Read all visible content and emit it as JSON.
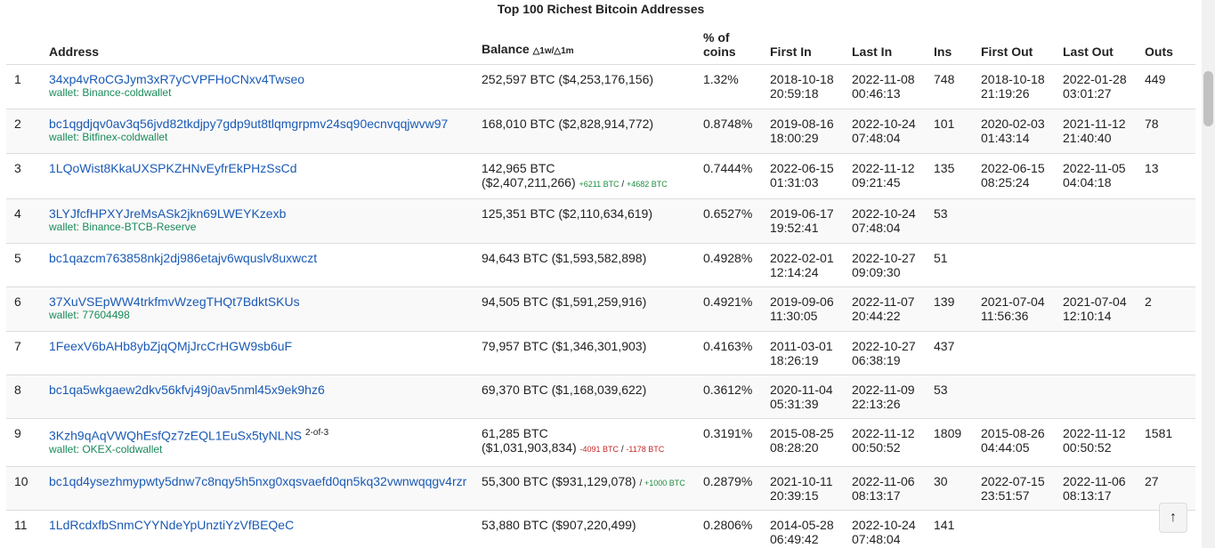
{
  "page": {
    "title": "Top 100 Richest Bitcoin Addresses"
  },
  "table": {
    "headers": {
      "address": "Address",
      "balance": "Balance",
      "balance_delta": "△1w/△1m",
      "pct_line1": "% of",
      "pct_line2": "coins",
      "first_in": "First In",
      "last_in": "Last In",
      "ins": "Ins",
      "first_out": "First Out",
      "last_out": "Last Out",
      "outs": "Outs"
    },
    "rows": [
      {
        "rank": "1",
        "address": "34xp4vRoCGJym3xR7yCVPFHoCNxv4Twseo",
        "wallet": "wallet: Binance-coldwallet",
        "balance": "252,597 BTC ($4,253,176,156)",
        "balance_l2": "",
        "delta_1w": "",
        "delta_1m": "",
        "delta_sign": "",
        "pct": "1.32%",
        "first_in_d": "2018-10-18",
        "first_in_t": "20:59:18",
        "last_in_d": "2022-11-08",
        "last_in_t": "00:46:13",
        "ins": "748",
        "first_out_d": "2018-10-18",
        "first_out_t": "21:19:26",
        "last_out_d": "2022-01-28",
        "last_out_t": "03:01:27",
        "outs": "449",
        "sup": ""
      },
      {
        "rank": "2",
        "address": "bc1qgdjqv0av3q56jvd82tkdjpy7gdp9ut8tlqmgrpmv24sq90ecnvqqjwvw97",
        "wallet": "wallet: Bitfinex-coldwallet",
        "balance": "168,010 BTC ($2,828,914,772)",
        "balance_l2": "",
        "delta_1w": "",
        "delta_1m": "",
        "delta_sign": "",
        "pct": "0.8748%",
        "first_in_d": "2019-08-16",
        "first_in_t": "18:00:29",
        "last_in_d": "2022-10-24",
        "last_in_t": "07:48:04",
        "ins": "101",
        "first_out_d": "2020-02-03",
        "first_out_t": "01:43:14",
        "last_out_d": "2021-11-12",
        "last_out_t": "21:40:40",
        "outs": "78",
        "sup": ""
      },
      {
        "rank": "3",
        "address": "1LQoWist8KkaUXSPKZHNvEyfrEkPHzSsCd",
        "wallet": "",
        "balance": "142,965 BTC",
        "balance_l2": "($2,407,211,266)",
        "delta_1w": "+6211 BTC",
        "delta_1m": "+4682 BTC",
        "delta_sign": "pos",
        "pct": "0.7444%",
        "first_in_d": "2022-06-15",
        "first_in_t": "01:31:03",
        "last_in_d": "2022-11-12",
        "last_in_t": "09:21:45",
        "ins": "135",
        "first_out_d": "2022-06-15",
        "first_out_t": "08:25:24",
        "last_out_d": "2022-11-05",
        "last_out_t": "04:04:18",
        "outs": "13",
        "sup": ""
      },
      {
        "rank": "4",
        "address": "3LYJfcfHPXYJreMsASk2jkn69LWEYKzexb",
        "wallet": "wallet: Binance-BTCB-Reserve",
        "balance": "125,351 BTC ($2,110,634,619)",
        "balance_l2": "",
        "delta_1w": "",
        "delta_1m": "",
        "delta_sign": "",
        "pct": "0.6527%",
        "first_in_d": "2019-06-17",
        "first_in_t": "19:52:41",
        "last_in_d": "2022-10-24",
        "last_in_t": "07:48:04",
        "ins": "53",
        "first_out_d": "",
        "first_out_t": "",
        "last_out_d": "",
        "last_out_t": "",
        "outs": "",
        "sup": ""
      },
      {
        "rank": "5",
        "address": "bc1qazcm763858nkj2dj986etajv6wquslv8uxwczt",
        "wallet": "",
        "balance": "94,643 BTC ($1,593,582,898)",
        "balance_l2": "",
        "delta_1w": "",
        "delta_1m": "",
        "delta_sign": "",
        "pct": "0.4928%",
        "first_in_d": "2022-02-01",
        "first_in_t": "12:14:24",
        "last_in_d": "2022-10-27",
        "last_in_t": "09:09:30",
        "ins": "51",
        "first_out_d": "",
        "first_out_t": "",
        "last_out_d": "",
        "last_out_t": "",
        "outs": "",
        "sup": ""
      },
      {
        "rank": "6",
        "address": "37XuVSEpWW4trkfmvWzegTHQt7BdktSKUs",
        "wallet": "wallet: 77604498",
        "balance": "94,505 BTC ($1,591,259,916)",
        "balance_l2": "",
        "delta_1w": "",
        "delta_1m": "",
        "delta_sign": "",
        "pct": "0.4921%",
        "first_in_d": "2019-09-06",
        "first_in_t": "11:30:05",
        "last_in_d": "2022-11-07",
        "last_in_t": "20:44:22",
        "ins": "139",
        "first_out_d": "2021-07-04",
        "first_out_t": "11:56:36",
        "last_out_d": "2021-07-04",
        "last_out_t": "12:10:14",
        "outs": "2",
        "sup": ""
      },
      {
        "rank": "7",
        "address": "1FeexV6bAHb8ybZjqQMjJrcCrHGW9sb6uF",
        "wallet": "",
        "balance": "79,957 BTC ($1,346,301,903)",
        "balance_l2": "",
        "delta_1w": "",
        "delta_1m": "",
        "delta_sign": "",
        "pct": "0.4163%",
        "first_in_d": "2011-03-01",
        "first_in_t": "18:26:19",
        "last_in_d": "2022-10-27",
        "last_in_t": "06:38:19",
        "ins": "437",
        "first_out_d": "",
        "first_out_t": "",
        "last_out_d": "",
        "last_out_t": "",
        "outs": "",
        "sup": ""
      },
      {
        "rank": "8",
        "address": "bc1qa5wkgaew2dkv56kfvj49j0av5nml45x9ek9hz6",
        "wallet": "",
        "balance": "69,370 BTC ($1,168,039,622)",
        "balance_l2": "",
        "delta_1w": "",
        "delta_1m": "",
        "delta_sign": "",
        "pct": "0.3612%",
        "first_in_d": "2020-11-04",
        "first_in_t": "05:31:39",
        "last_in_d": "2022-11-09",
        "last_in_t": "22:13:26",
        "ins": "53",
        "first_out_d": "",
        "first_out_t": "",
        "last_out_d": "",
        "last_out_t": "",
        "outs": "",
        "sup": ""
      },
      {
        "rank": "9",
        "address": "3Kzh9qAqVWQhEsfQz7zEQL1EuSx5tyNLNS",
        "wallet": "wallet: OKEX-coldwallet",
        "balance": "61,285 BTC",
        "balance_l2": "($1,031,903,834)",
        "delta_1w": "-4091 BTC",
        "delta_1m": "-1178 BTC",
        "delta_sign": "neg",
        "pct": "0.3191%",
        "first_in_d": "2015-08-25",
        "first_in_t": "08:28:20",
        "last_in_d": "2022-11-12",
        "last_in_t": "00:50:52",
        "ins": "1809",
        "first_out_d": "2015-08-26",
        "first_out_t": "04:44:05",
        "last_out_d": "2022-11-12",
        "last_out_t": "00:50:52",
        "outs": "1581",
        "sup": "2-of-3"
      },
      {
        "rank": "10",
        "address": "bc1qd4ysezhmypwty5dnw7c8nqy5h5nxg0xqsvaefd0qn5kq32vwnwqqgv4rzr",
        "wallet": "",
        "balance": "55,300 BTC ($931,129,078)",
        "balance_l2": "",
        "delta_1w": "",
        "delta_1m": "+1000 BTC",
        "delta_sign": "pos",
        "pct": "0.2879%",
        "first_in_d": "2021-10-11",
        "first_in_t": "20:39:15",
        "last_in_d": "2022-11-06",
        "last_in_t": "08:13:17",
        "ins": "30",
        "first_out_d": "2022-07-15",
        "first_out_t": "23:51:57",
        "last_out_d": "2022-11-06",
        "last_out_t": "08:13:17",
        "outs": "27",
        "sup": ""
      },
      {
        "rank": "11",
        "address": "1LdRcdxfbSnmCYYNdeYpUnztiYzVfBEQeC",
        "wallet": "",
        "balance": "53,880 BTC ($907,220,499)",
        "balance_l2": "",
        "delta_1w": "",
        "delta_1m": "",
        "delta_sign": "",
        "pct": "0.2806%",
        "first_in_d": "2014-05-28",
        "first_in_t": "06:49:42",
        "last_in_d": "2022-10-24",
        "last_in_t": "07:48:04",
        "ins": "141",
        "first_out_d": "",
        "first_out_t": "",
        "last_out_d": "",
        "last_out_t": "",
        "outs": "",
        "sup": ""
      }
    ]
  },
  "controls": {
    "back_to_top": "↑"
  }
}
